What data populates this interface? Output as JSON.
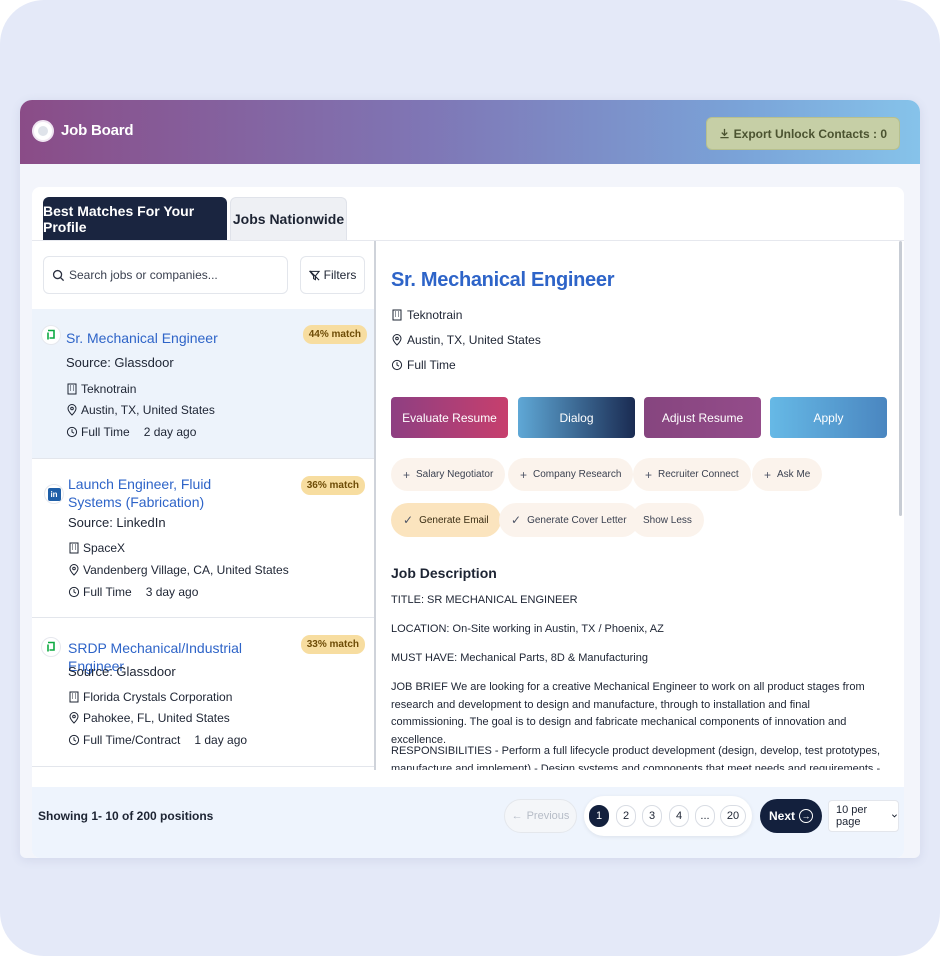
{
  "app": {
    "title": "Job Board",
    "export_label": "Export Unlock Contacts : 0"
  },
  "tabs": [
    {
      "label": "Best Matches For Your Profile"
    },
    {
      "label": "Jobs Nationwide"
    }
  ],
  "search": {
    "placeholder": "Search jobs or companies...",
    "filters_label": "Filters"
  },
  "jobs": [
    {
      "title": "Sr. Mechanical Engineer",
      "match": "44% match",
      "source": "Source: Glassdoor",
      "company": "Teknotrain",
      "location": "Austin, TX, United States",
      "type": "Full Time",
      "posted": "2 day ago",
      "source_icon": "glassdoor-icon"
    },
    {
      "title": "Launch Engineer, Fluid Systems (Fabrication)",
      "match": "36% match",
      "source": "Source: LinkedIn",
      "company": "SpaceX",
      "location": "Vandenberg Village, CA, United States",
      "type": "Full Time",
      "posted": "3 day ago",
      "source_icon": "linkedin-icon"
    },
    {
      "title": "SRDP Mechanical/Industrial Engineer",
      "match": "33% match",
      "source": "Source: Glassdoor",
      "company": "Florida Crystals Corporation",
      "location": "Pahokee, FL, United States",
      "type": "Full Time/Contract",
      "posted": "1 day ago",
      "source_icon": "glassdoor-icon"
    }
  ],
  "detail": {
    "title": "Sr. Mechanical Engineer",
    "company": "Teknotrain",
    "location": "Austin, TX, United States",
    "type": "Full Time",
    "actions": [
      "Evaluate Resume",
      "Dialog",
      "Adjust Resume",
      "Apply"
    ],
    "chips": [
      "Salary Negotiator",
      "Company Research",
      "Recruiter Connect",
      "Ask Me",
      "Generate Email",
      "Generate Cover Letter",
      "Show Less"
    ],
    "description_heading": "Job Description",
    "paragraphs": [
      "TITLE: SR MECHANICAL ENGINEER",
      "LOCATION: On-Site working in Austin, TX / Phoenix, AZ",
      "MUST HAVE: Mechanical Parts, 8D & Manufacturing",
      "JOB BRIEF We are looking for a creative Mechanical Engineer to work on all product stages from research and development to design and manufacture, through to installation and final commissioning. The goal is to design and fabricate mechanical components of innovation and excellence.",
      "RESPONSIBILITIES - Perform a full lifecycle product development (design, develop, test prototypes, manufacture and implement) - Design systems and components that meet needs and requirements - Produce outline designs"
    ]
  },
  "pagination": {
    "showing": "Showing 1- 10 of 200 positions",
    "previous": "Previous",
    "pages": [
      "1",
      "2",
      "3",
      "4",
      "...",
      "20"
    ],
    "next": "Next",
    "per_page": "10 per page"
  }
}
